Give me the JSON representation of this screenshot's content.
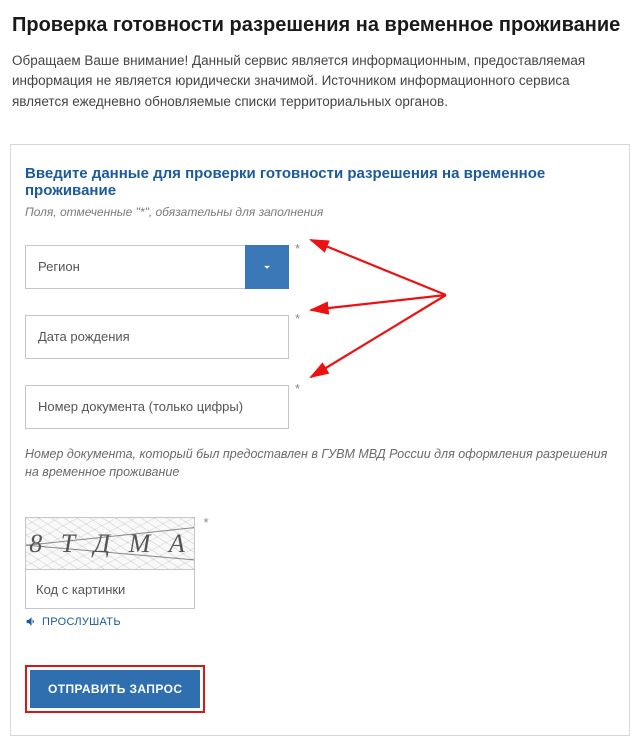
{
  "page": {
    "title": "Проверка готовности разрешения на временное проживание",
    "intro": "Обращаем Ваше внимание! Данный сервис является информационным, предоставляемая информация не является юридически значимой. Источником информационного сервиса является ежедневно обновляемые списки территориальных органов."
  },
  "form": {
    "title": "Введите данные для проверки готовности разрешения на временное проживание",
    "required_note": "Поля, отмеченные \"*\", обязательны для заполнения",
    "region": {
      "placeholder": "Регион",
      "value": ""
    },
    "dob": {
      "placeholder": "Дата рождения",
      "value": ""
    },
    "doc": {
      "placeholder": "Номер документа (только цифры)",
      "value": "",
      "hint": "Номер документа, который был предоставлен в ГУВМ МВД России для оформления разрешения на временное проживание"
    },
    "captcha": {
      "image_text": "8 Т Д М А",
      "placeholder": "Код с картинки",
      "listen_label": "ПРОСЛУШАТЬ"
    },
    "submit_label": "ОТПРАВИТЬ ЗАПРОС",
    "asterisk": "*"
  },
  "icons": {
    "chevron_down": "chevron-down-icon",
    "speaker": "speaker-icon"
  },
  "colors": {
    "accent": "#2f6fb0",
    "link": "#1b5a9b",
    "highlight_border": "#d11a1a",
    "arrow": "#e11"
  }
}
